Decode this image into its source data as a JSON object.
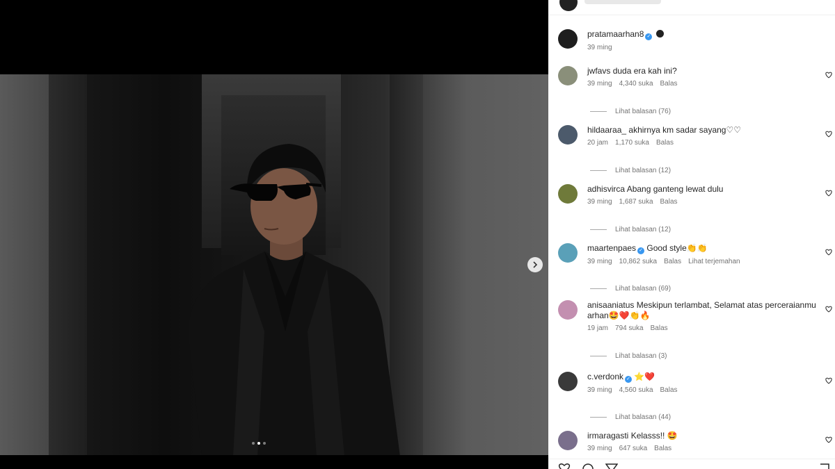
{
  "post": {
    "author": "pratamaarhan8",
    "author_time": "39 ming"
  },
  "carousel": {
    "dots": 3,
    "active": 1
  },
  "labels": {
    "view_replies_prefix": "Lihat balasan"
  },
  "comments": [
    {
      "user": "jwfavs",
      "text": "duda era kah ini?",
      "time": "39 ming",
      "likes": "4,340 suka",
      "reply": "Balas",
      "replies": "Lihat balasan (76)"
    },
    {
      "user": "hildaaraa_",
      "text": "akhirnya km sadar sayang♡♡",
      "time": "20 jam",
      "likes": "1,170 suka",
      "reply": "Balas",
      "replies": "Lihat balasan (12)"
    },
    {
      "user": "adhisvirca",
      "text": "Abang ganteng lewat dulu",
      "time": "39 ming",
      "likes": "1,687 suka",
      "reply": "Balas",
      "replies": "Lihat balasan (12)"
    },
    {
      "user": "maartenpaes",
      "text": "Good style👏👏",
      "time": "39 ming",
      "likes": "10,862 suka",
      "reply": "Balas",
      "translate": "Lihat terjemahan",
      "replies": "Lihat balasan (69)",
      "verified": true
    },
    {
      "user": "anisaaniatus",
      "text": "Meskipun terlambat, Selamat atas perceraianmu arhan🤩❤️👏🔥",
      "time": "19 jam",
      "likes": "794 suka",
      "reply": "Balas",
      "replies": "Lihat balasan (3)"
    },
    {
      "user": "c.verdonk",
      "text": "⭐❤️",
      "time": "39 ming",
      "likes": "4,560 suka",
      "reply": "Balas",
      "replies": "Lihat balasan (44)",
      "verified": true
    },
    {
      "user": "irmaragasti",
      "text": "Kelasss!! 🤩",
      "time": "39 ming",
      "likes": "647 suka",
      "reply": "Balas"
    }
  ],
  "colors": {
    "verified": "#3897f0",
    "meta": "#737373",
    "text": "#262626"
  },
  "icons": [
    "chevron-right-icon",
    "heart-icon",
    "comment-icon",
    "share-icon",
    "bookmark-icon",
    "verified-icon"
  ]
}
